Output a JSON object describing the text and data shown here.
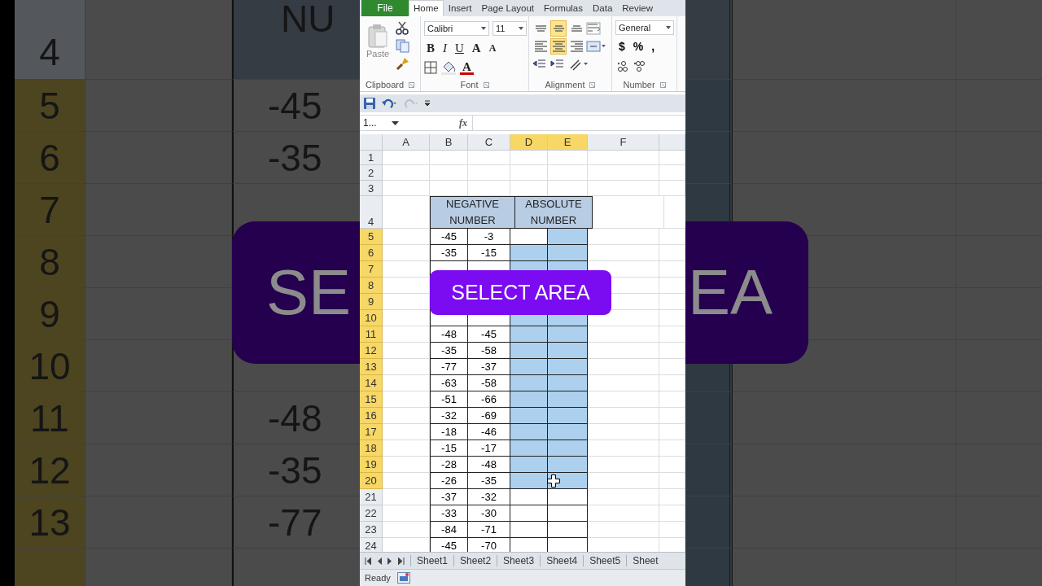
{
  "backdrop": {
    "header_row": {
      "label": "4",
      "lines": [
        "NU"
      ]
    },
    "rows": [
      {
        "label": "5",
        "selected": true,
        "value": "-45"
      },
      {
        "label": "6",
        "selected": true,
        "value": "-35"
      },
      {
        "label": "7",
        "selected": true
      },
      {
        "label": "8",
        "selected": true
      },
      {
        "label": "9",
        "selected": true
      },
      {
        "label": "10",
        "selected": true
      },
      {
        "label": "11",
        "selected": true,
        "value": "-48"
      },
      {
        "label": "12",
        "selected": true,
        "value": "-35"
      },
      {
        "label": "13",
        "selected": true,
        "value": "-77"
      },
      {
        "selected": true
      }
    ],
    "right_rows": [
      {
        "selected": true
      },
      {
        "selected": true
      },
      {
        "selected": true
      },
      {},
      {},
      {
        "selected": true
      },
      {
        "selected": true
      },
      {
        "selected": true
      },
      {
        "selected": true
      },
      {
        "selected": true
      }
    ],
    "left_badge": "SE",
    "right_badge": "EA"
  },
  "ribbon": {
    "file_tab": "File",
    "tabs": [
      {
        "label": "Home",
        "selected": true
      },
      {
        "label": "Insert",
        "selected": false
      },
      {
        "label": "Page Layout",
        "selected": false
      },
      {
        "label": "Formulas",
        "selected": false
      },
      {
        "label": "Data",
        "selected": false
      },
      {
        "label": "Review",
        "selected": false
      }
    ],
    "clipboard": {
      "label": "Clipboard",
      "paste": "Paste"
    },
    "font": {
      "label": "Font",
      "name": "Calibri",
      "size": "11",
      "bold": "B",
      "italic": "I",
      "underline": "U",
      "grow": "A",
      "shrink": "A",
      "font_color_letter": "A"
    },
    "alignment": {
      "label": "Alignment",
      "buttons": [
        {
          "kind": "top",
          "selected": false
        },
        {
          "kind": "middle",
          "selected": true
        },
        {
          "kind": "bottom",
          "selected": false
        },
        {
          "kind": "left",
          "selected": false
        },
        {
          "kind": "center",
          "selected": true
        },
        {
          "kind": "right",
          "selected": false
        }
      ]
    },
    "number": {
      "label": "Number",
      "format": "General",
      "currency": "$",
      "percent": "%",
      "comma": ","
    }
  },
  "formula_bar": {
    "name_box": "1...",
    "fx": "fx"
  },
  "sheet": {
    "columns": [
      {
        "label": "A",
        "selected": false
      },
      {
        "label": "B",
        "selected": false
      },
      {
        "label": "C",
        "selected": false
      },
      {
        "label": "D",
        "selected": true
      },
      {
        "label": "E",
        "selected": true
      },
      {
        "label": "F",
        "selected": false
      }
    ],
    "header_row": {
      "label": "4",
      "selected": false,
      "headers": [
        "NEGATIVE NUMBER",
        "ABSOLUTE NUMBER"
      ]
    },
    "blank_rows": [
      {
        "label": "1",
        "selected": false
      },
      {
        "label": "2",
        "selected": false
      },
      {
        "label": "3",
        "selected": false
      }
    ],
    "rows": [
      {
        "label": "5",
        "selected": true,
        "values": [
          "-45",
          "-3"
        ],
        "fill": [
          false,
          true
        ]
      },
      {
        "label": "6",
        "selected": true,
        "values": [
          "-35",
          "-15"
        ],
        "fill": [
          true,
          true
        ]
      },
      {
        "label": "7",
        "selected": true,
        "fill": [
          true,
          true
        ]
      },
      {
        "label": "8",
        "selected": true
      },
      {
        "label": "9",
        "selected": true
      },
      {
        "label": "10",
        "selected": true,
        "fill": [
          true,
          true
        ]
      },
      {
        "label": "11",
        "selected": true,
        "values": [
          "-48",
          "-45"
        ],
        "fill": [
          true,
          true
        ]
      },
      {
        "label": "12",
        "selected": true,
        "values": [
          "-35",
          "-58"
        ],
        "fill": [
          true,
          true
        ]
      },
      {
        "label": "13",
        "selected": true,
        "values": [
          "-77",
          "-37"
        ],
        "fill": [
          true,
          true
        ]
      },
      {
        "label": "14",
        "selected": true,
        "values": [
          "-63",
          "-58"
        ],
        "fill": [
          true,
          true
        ]
      },
      {
        "label": "15",
        "selected": true,
        "values": [
          "-51",
          "-66"
        ],
        "fill": [
          true,
          true
        ]
      },
      {
        "label": "16",
        "selected": true,
        "values": [
          "-32",
          "-69"
        ],
        "fill": [
          true,
          true
        ]
      },
      {
        "label": "17",
        "selected": true,
        "values": [
          "-18",
          "-46"
        ],
        "fill": [
          true,
          true
        ]
      },
      {
        "label": "18",
        "selected": true,
        "values": [
          "-15",
          "-17"
        ],
        "fill": [
          true,
          true
        ]
      },
      {
        "label": "19",
        "selected": true,
        "values": [
          "-28",
          "-48"
        ],
        "fill": [
          true,
          true
        ]
      },
      {
        "label": "20",
        "selected": true,
        "values": [
          "-26",
          "-35"
        ],
        "fill": [
          true,
          true
        ]
      },
      {
        "label": "21",
        "selected": false,
        "values": [
          "-37",
          "-32"
        ],
        "fill": [
          false,
          false
        ]
      },
      {
        "label": "22",
        "selected": false,
        "values": [
          "-33",
          "-30"
        ],
        "fill": [
          false,
          false
        ]
      },
      {
        "label": "23",
        "selected": false,
        "values": [
          "-84",
          "-71"
        ],
        "fill": [
          false,
          false
        ]
      },
      {
        "label": "24",
        "selected": false,
        "values": [
          "-45",
          "-70"
        ],
        "fill": [
          false,
          false
        ]
      }
    ]
  },
  "sheet_tabs": [
    "Sheet1",
    "Sheet2",
    "Sheet3",
    "Sheet4",
    "Sheet5",
    "Sheet"
  ],
  "status_bar": {
    "text": "Ready"
  },
  "overlay": {
    "caption": "SELECT AREA"
  }
}
